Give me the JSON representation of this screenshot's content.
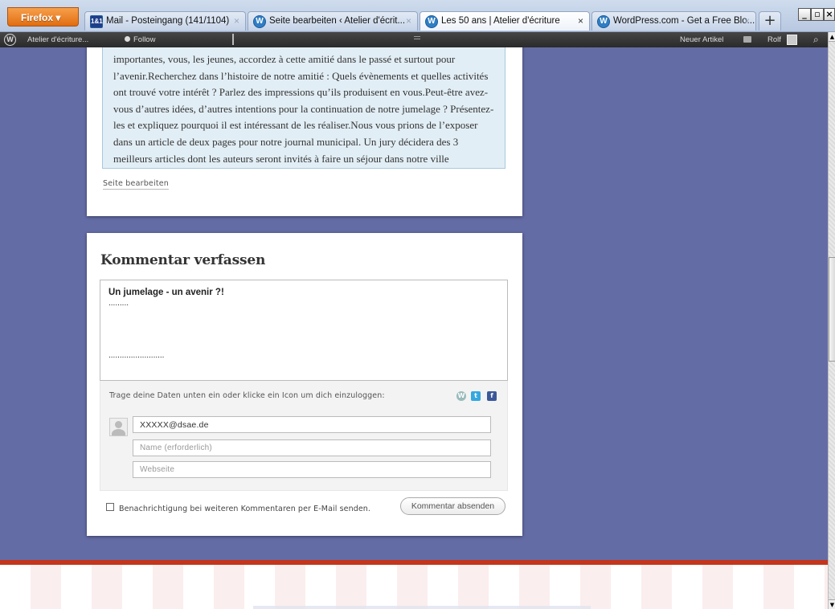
{
  "browser": {
    "menu_label": "Firefox",
    "tabs": [
      {
        "label": "Mail - Posteingang (141/1104)",
        "close": "×"
      },
      {
        "label": "Seite bearbeiten ‹ Atelier d'écrit...",
        "close": "×"
      },
      {
        "label": "Les 50 ans | Atelier d'écriture",
        "close": "×"
      },
      {
        "label": "WordPress.com - Get a Free Blo...",
        "close": "×"
      }
    ],
    "new_tab": "+",
    "window_controls": {
      "minimize": "_",
      "maximize": "▫",
      "close": "×"
    },
    "tab_icons": [
      "mail-icon",
      "wordpress-icon",
      "wordpress-icon",
      "wordpress-icon"
    ]
  },
  "adminbar": {
    "logo": "W",
    "site_name": "Atelier d'écriture...",
    "follow": "Follow",
    "new_post": "Neuer Artikel",
    "user": "Rolf",
    "search_icon": "search-icon"
  },
  "post": {
    "excerpt": "importantes, vous, les jeunes, accordez à cette amitié dans le passé et surtout pour l’avenir.Recherchez dans l’histoire de notre amitié : Quels évènements et quelles activités ont trouvé votre intérêt ? Parlez des impressions qu’ils produisent en vous.Peut-être avez-vous d’autres idées, d’autres intentions pour la continuation de notre jumelage ? Présentez-les et expliquez pourquoi il est intéressant de les réaliser.Nous vous prions de l’exposer dans un article de deux pages pour notre journal municipal. Un jury  décidera des 3 meilleurs articles dont les auteurs seront invités à faire un séjour dans notre ville comprenant également une excursion à Paris.............Maire de …",
    "edit_link": "Seite bearbeiten"
  },
  "comment_form": {
    "title": "Kommentar verfassen",
    "textarea": {
      "title_line": "Un jumelage - un avenir ?!",
      "dots_line_1": ".........",
      "dots_line_2": "........................."
    },
    "login_prompt": "Trage deine Daten unten ein oder klicke ein Icon um dich einzuloggen:",
    "email_value": "XXXXX@dsae.de",
    "name_placeholder": "Name (erforderlich)",
    "url_placeholder": "Webseite",
    "subscribe_label": "Benachrichtigung bei weiteren Kommentaren per E-Mail senden.",
    "submit_label": "Kommentar absenden"
  },
  "colors": {
    "page_background": "#646ca6",
    "quote_background": "#e2eef5",
    "footer_accent": "#c3351c",
    "adminbar": "#333333"
  }
}
